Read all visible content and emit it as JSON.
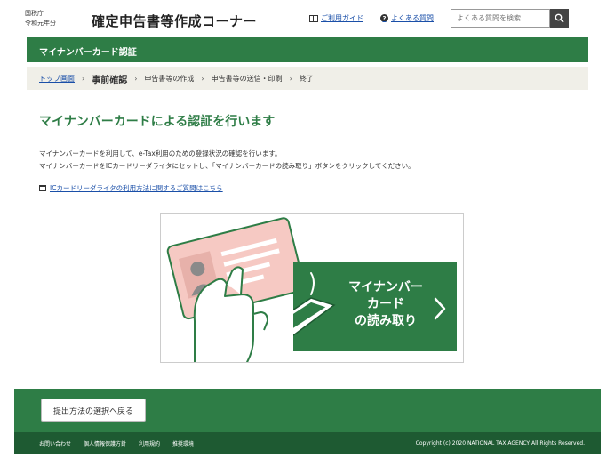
{
  "header": {
    "agency_line1": "国税庁",
    "agency_line2": "令和元年分",
    "site_title": "確定申告書等作成コーナー",
    "guide_label": "ご利用ガイド",
    "faq_label": "よくある質問",
    "search_placeholder": "よくある質問を検索",
    "icons": [
      "book-icon",
      "question-icon",
      "search-icon"
    ]
  },
  "band": {
    "title": "マイナンバーカード認証"
  },
  "breadcrumb": {
    "items": [
      {
        "label": "トップ画面",
        "kind": "link"
      },
      {
        "label": "事前確認",
        "kind": "current"
      },
      {
        "label": "申告書等の作成",
        "kind": "step"
      },
      {
        "label": "申告書等の送信・印刷",
        "kind": "step"
      },
      {
        "label": "終了",
        "kind": "step"
      }
    ],
    "separator": "›"
  },
  "main": {
    "title": "マイナンバーカードによる認証を行います",
    "desc_line1": "マイナンバーカードを利用して、e-Tax利用のための登録状況の確認を行います。",
    "desc_line2": "マイナンバーカードをICカードリーダライタにセットし、「マイナンバーカードの読み取り」ボタンをクリックしてください。",
    "help_link": "ICカードリーダライタの利用方法に関するご質問はこちら",
    "read_button": {
      "line1": "マイナンバー",
      "line2": "カード",
      "line3": "の読み取り"
    }
  },
  "footer": {
    "back_label": "提出方法の選択へ戻る",
    "links": [
      "お問い合わせ",
      "個人情報保護方針",
      "利用規約",
      "推奨環境"
    ],
    "copyright": "Copyright (c) 2020 NATIONAL TAX AGENCY All Rights Reserved."
  },
  "colors": {
    "brand_green": "#2e7d46",
    "dark_green": "#1e5a32",
    "link_blue": "#1a4fa8",
    "card_pink": "#f6c9c3"
  }
}
